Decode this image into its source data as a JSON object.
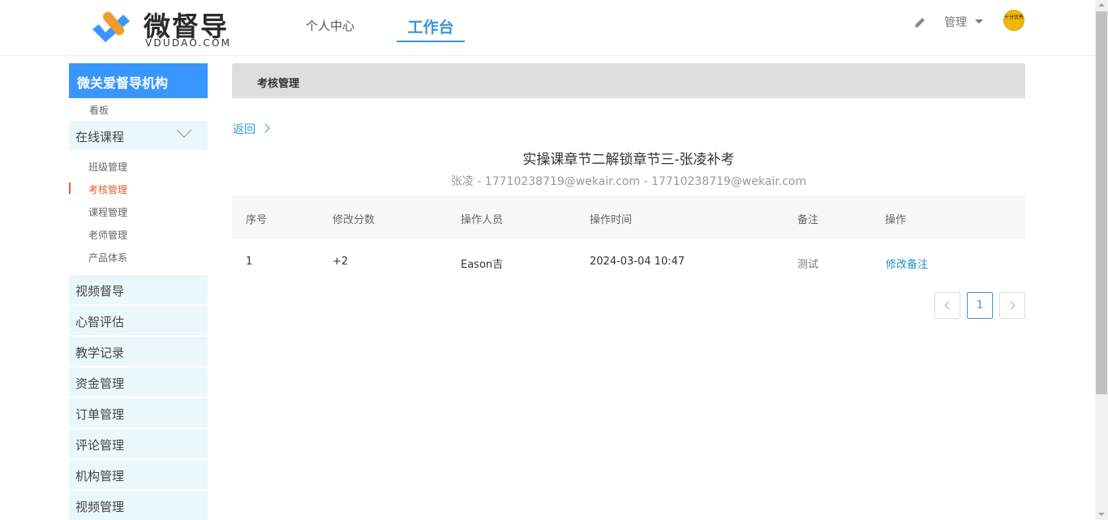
{
  "header": {
    "logo_name": "微督导",
    "logo_sub": "VDUDAO.COM",
    "nav": {
      "personal": "个人中心",
      "workbench": "工作台"
    },
    "admin_label": "管理",
    "avatar_text": "十分优秀"
  },
  "sidebar": {
    "org": "微关爱督导机构",
    "board": "看板",
    "online_course": "在线课程",
    "course_subitems": [
      "班级管理",
      "考核管理",
      "课程管理",
      "老师管理",
      "产品体系"
    ],
    "active_subitem": "考核管理",
    "items": [
      "视频督导",
      "心智评估",
      "教学记录",
      "资金管理",
      "订单管理",
      "评论管理",
      "机构管理",
      "视频管理"
    ]
  },
  "main": {
    "breadcrumb": "考核管理",
    "back": "返回",
    "title": "实操课章节二解锁章节三-张凌补考",
    "subtitle": "张凌 - 17710238719@wekair.com - 17710238719@wekair.com",
    "table": {
      "columns": [
        "序号",
        "修改分数",
        "操作人员",
        "操作时间",
        "备注",
        "操作"
      ],
      "rows": [
        {
          "index": "1",
          "score": "+2",
          "operator": "Eason吉",
          "time": "2024-03-04 10:47",
          "note": "测试",
          "action": "修改备注"
        }
      ]
    },
    "pagination": {
      "current": "1"
    }
  },
  "colors": {
    "accent": "#3a96ff",
    "link": "#3a96d8",
    "active": "#e0602b",
    "sidebar_bg": "#eaf7fb"
  }
}
